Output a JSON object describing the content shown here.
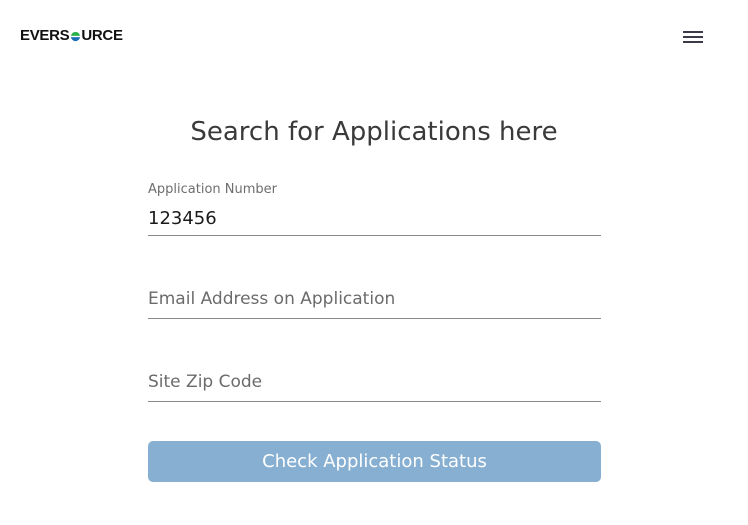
{
  "header": {
    "logo_text_left": "EVERS",
    "logo_text_right": "URCE",
    "menu_icon": "hamburger-menu-icon"
  },
  "main": {
    "title": "Search for Applications here",
    "fields": [
      {
        "label": "Application Number",
        "value": "123456",
        "placeholder": ""
      },
      {
        "label": "",
        "value": "",
        "placeholder": "Email Address on Application"
      },
      {
        "label": "",
        "value": "",
        "placeholder": "Site Zip Code"
      }
    ],
    "submit_label": "Check Application Status"
  },
  "colors": {
    "button_bg": "#86afd1",
    "logo_green": "#2bb24c",
    "logo_blue": "#1d6fb8"
  }
}
